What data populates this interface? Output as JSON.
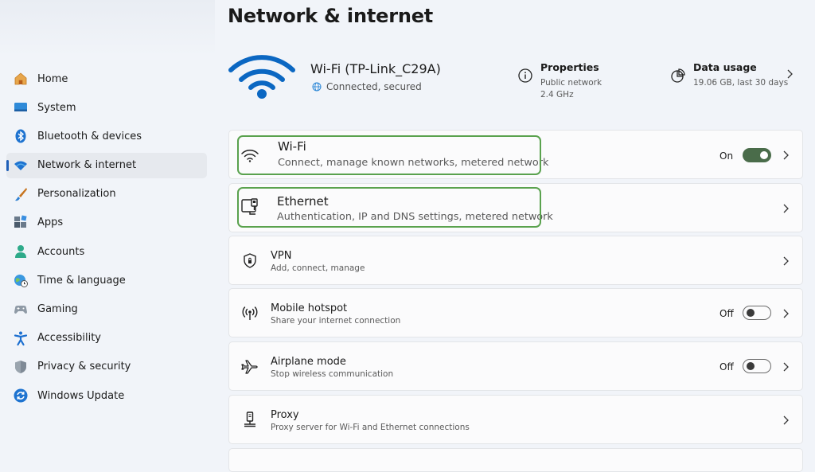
{
  "page": {
    "title": "Network & internet"
  },
  "sidebar": {
    "items": [
      {
        "label": "Home",
        "icon": "home-icon",
        "active": false
      },
      {
        "label": "System",
        "icon": "system-display-icon",
        "active": false
      },
      {
        "label": "Bluetooth & devices",
        "icon": "bluetooth-icon",
        "active": false
      },
      {
        "label": "Network & internet",
        "icon": "wifi-icon",
        "active": true
      },
      {
        "label": "Personalization",
        "icon": "paintbrush-icon",
        "active": false
      },
      {
        "label": "Apps",
        "icon": "apps-icon",
        "active": false
      },
      {
        "label": "Accounts",
        "icon": "person-icon",
        "active": false
      },
      {
        "label": "Time & language",
        "icon": "globe-clock-icon",
        "active": false
      },
      {
        "label": "Gaming",
        "icon": "gamepad-icon",
        "active": false
      },
      {
        "label": "Accessibility",
        "icon": "accessibility-icon",
        "active": false
      },
      {
        "label": "Privacy & security",
        "icon": "shield-icon",
        "active": false
      },
      {
        "label": "Windows Update",
        "icon": "update-icon",
        "active": false
      }
    ]
  },
  "hero": {
    "network_name": "Wi-Fi (TP-Link_C29A)",
    "status": "Connected, secured",
    "properties": {
      "title": "Properties",
      "line1": "Public network",
      "line2": "2.4 GHz"
    },
    "data_usage": {
      "title": "Data usage",
      "line1": "19.06 GB, last 30 days"
    }
  },
  "cards": {
    "wifi": {
      "title": "Wi-Fi",
      "subtitle": "Connect, manage known networks, metered network",
      "state": "On"
    },
    "ethernet": {
      "title": "Ethernet",
      "subtitle": "Authentication, IP and DNS settings, metered network"
    },
    "vpn": {
      "title": "VPN",
      "subtitle": "Add, connect, manage"
    },
    "hotspot": {
      "title": "Mobile hotspot",
      "subtitle": "Share your internet connection",
      "state": "Off"
    },
    "airplane": {
      "title": "Airplane mode",
      "subtitle": "Stop wireless communication",
      "state": "Off"
    },
    "proxy": {
      "title": "Proxy",
      "subtitle": "Proxy server for Wi-Fi and Ethernet connections"
    }
  },
  "colors": {
    "accent": "#1f5fb8",
    "wifi_blue": "#0b67c2",
    "toggle_on": "#4a6c4a",
    "highlight": "#5aa24e"
  }
}
